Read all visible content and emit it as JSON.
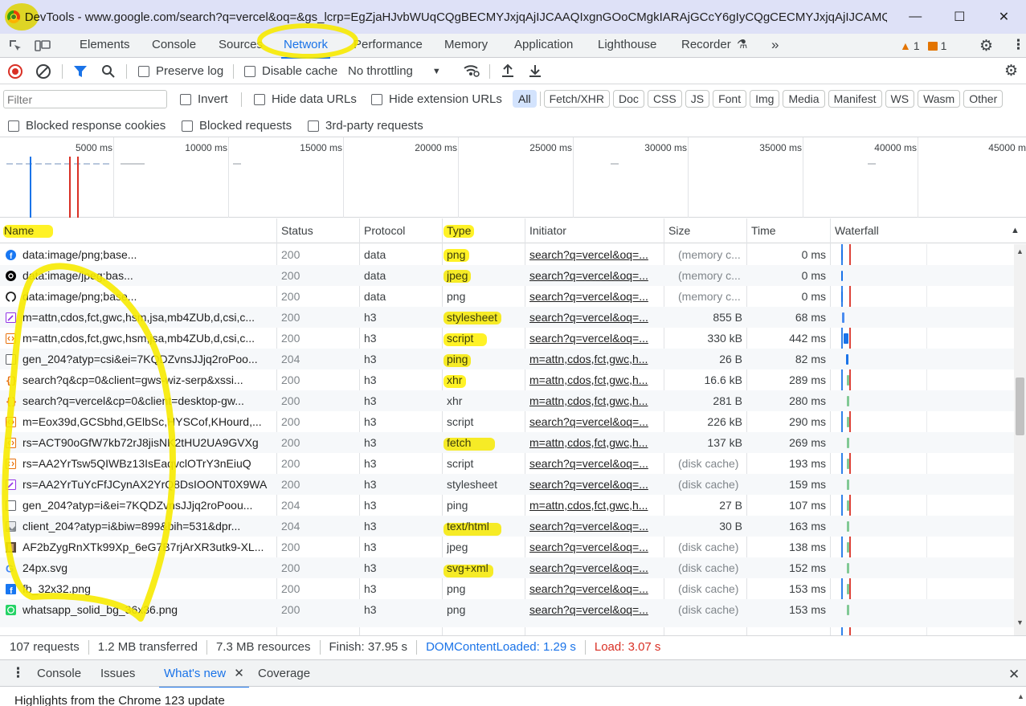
{
  "window": {
    "title": "DevTools - www.google.com/search?q=vercel&oq=&gs_lcrp=EgZjaHJvbWUqCQgBECMYJxjqAjIJCAAQIxgnGOoCMgkIARAjGCcY6gIyCQgCECMYJxjqAjIJCAMQI...",
    "minimize": "—",
    "maximize": "☐",
    "close": "✕"
  },
  "panel_tabs": [
    "Elements",
    "Console",
    "Sources",
    "Network",
    "Performance",
    "Memory",
    "Application",
    "Lighthouse",
    "Recorder"
  ],
  "active_panel": "Network",
  "more_tabs": "»",
  "warnings": {
    "warn_count": "1",
    "issue_count": "1"
  },
  "toolbar": {
    "preserve_log": "Preserve log",
    "disable_cache": "Disable cache",
    "throttling": "No throttling"
  },
  "filter_bar": {
    "placeholder": "Filter",
    "invert": "Invert",
    "hide_data_urls": "Hide data URLs",
    "hide_extension_urls": "Hide extension URLs",
    "types": [
      "All",
      "Fetch/XHR",
      "Doc",
      "CSS",
      "JS",
      "Font",
      "Img",
      "Media",
      "Manifest",
      "WS",
      "Wasm",
      "Other"
    ],
    "active_type": "All"
  },
  "blocked_bar": {
    "blocked_cookies": "Blocked response cookies",
    "blocked_requests": "Blocked requests",
    "third_party": "3rd-party requests"
  },
  "overview": {
    "ticks": [
      "5000 ms",
      "10000 ms",
      "15000 ms",
      "20000 ms",
      "25000 ms",
      "30000 ms",
      "35000 ms",
      "40000 ms",
      "45000 m"
    ]
  },
  "columns": [
    "Name",
    "Status",
    "Protocol",
    "Type",
    "Initiator",
    "Size",
    "Time",
    "Waterfall"
  ],
  "requests": [
    {
      "name": "data:image/png;base...",
      "status": "200",
      "protocol": "data",
      "type": "png",
      "initiator": "search?q=vercel&oq=...",
      "size": "(memory c...",
      "time": "0 ms",
      "icon": "facebook-icon"
    },
    {
      "name": "data:image/jpeg;bas...",
      "status": "200",
      "protocol": "data",
      "type": "jpeg",
      "initiator": "search?q=vercel&oq=...",
      "size": "(memory c...",
      "time": "0 ms",
      "icon": "threads-icon"
    },
    {
      "name": "data:image/png;base...",
      "status": "200",
      "protocol": "data",
      "type": "png",
      "initiator": "search?q=vercel&oq=...",
      "size": "(memory c...",
      "time": "0 ms",
      "icon": "github-icon"
    },
    {
      "name": "m=attn,cdos,fct,gwc,hsm,jsa,mb4ZUb,d,csi,c...",
      "status": "200",
      "protocol": "h3",
      "type": "stylesheet",
      "initiator": "search?q=vercel&oq=...",
      "size": "855 B",
      "time": "68 ms",
      "icon": "stylesheet-icon"
    },
    {
      "name": "m=attn,cdos,fct,gwc,hsm,jsa,mb4ZUb,d,csi,c...",
      "status": "200",
      "protocol": "h3",
      "type": "script",
      "initiator": "search?q=vercel&oq=...",
      "size": "330 kB",
      "time": "442 ms",
      "icon": "script-icon"
    },
    {
      "name": "gen_204?atyp=csi&ei=7KQDZvnsJJjq2roPoo...",
      "status": "204",
      "protocol": "h3",
      "type": "ping",
      "initiator": "m=attn,cdos,fct,gwc,h...",
      "size": "26 B",
      "time": "82 ms",
      "icon": "document-icon"
    },
    {
      "name": "search?q&cp=0&client=gws-wiz-serp&xssi...",
      "status": "200",
      "protocol": "h3",
      "type": "xhr",
      "initiator": "m=attn,cdos,fct,gwc,h...",
      "size": "16.6 kB",
      "time": "289 ms",
      "icon": "xhr-icon"
    },
    {
      "name": "search?q=vercel&cp=0&client=desktop-gw...",
      "status": "200",
      "protocol": "h3",
      "type": "xhr",
      "initiator": "m=attn,cdos,fct,gwc,h...",
      "size": "281 B",
      "time": "280 ms",
      "icon": "xhr-icon"
    },
    {
      "name": "m=Eox39d,GCSbhd,GElbSc,HYSCof,KHourd,...",
      "status": "200",
      "protocol": "h3",
      "type": "script",
      "initiator": "search?q=vercel&oq=...",
      "size": "226 kB",
      "time": "290 ms",
      "icon": "script-icon"
    },
    {
      "name": "rs=ACT90oGfW7kb72rJ8jisNK2tHU2UA9GVXg",
      "status": "200",
      "protocol": "h3",
      "type": "fetch",
      "initiator": "m=attn,cdos,fct,gwc,h...",
      "size": "137 kB",
      "time": "269 ms",
      "icon": "script-icon"
    },
    {
      "name": "rs=AA2YrTsw5QIWBz13IsEaqvclOTrY3nEiuQ",
      "status": "200",
      "protocol": "h3",
      "type": "script",
      "initiator": "search?q=vercel&oq=...",
      "size": "(disk cache)",
      "time": "193 ms",
      "icon": "script-icon"
    },
    {
      "name": "rs=AA2YrTuYcFfJCynAX2YrQ8DsIOONT0X9WA",
      "status": "200",
      "protocol": "h3",
      "type": "stylesheet",
      "initiator": "search?q=vercel&oq=...",
      "size": "(disk cache)",
      "time": "159 ms",
      "icon": "stylesheet-icon"
    },
    {
      "name": "gen_204?atyp=i&ei=7KQDZvnsJJjq2roPoou...",
      "status": "204",
      "protocol": "h3",
      "type": "ping",
      "initiator": "m=attn,cdos,fct,gwc,h...",
      "size": "27 B",
      "time": "107 ms",
      "icon": "document-icon"
    },
    {
      "name": "client_204?atyp=i&biw=899&bih=531&dpr...",
      "status": "204",
      "protocol": "h3",
      "type": "text/html",
      "initiator": "search?q=vercel&oq=...",
      "size": "30 B",
      "time": "163 ms",
      "icon": "image-icon"
    },
    {
      "name": "AF2bZygRnXTk99Xp_6eG7B7rjArXR3utk9-XL...",
      "status": "200",
      "protocol": "h3",
      "type": "jpeg",
      "initiator": "search?q=vercel&oq=...",
      "size": "(disk cache)",
      "time": "138 ms",
      "icon": "photo-icon"
    },
    {
      "name": "24px.svg",
      "status": "200",
      "protocol": "h3",
      "type": "svg+xml",
      "initiator": "search?q=vercel&oq=...",
      "size": "(disk cache)",
      "time": "152 ms",
      "icon": "google-icon"
    },
    {
      "name": "fb_32x32.png",
      "status": "200",
      "protocol": "h3",
      "type": "png",
      "initiator": "search?q=vercel&oq=...",
      "size": "(disk cache)",
      "time": "153 ms",
      "icon": "facebook-square-icon"
    },
    {
      "name": "whatsapp_solid_bg_36x36.png",
      "status": "200",
      "protocol": "h3",
      "type": "png",
      "initiator": "search?q=vercel&oq=...",
      "size": "(disk cache)",
      "time": "153 ms",
      "icon": "whatsapp-icon"
    }
  ],
  "summary": {
    "requests": "107 requests",
    "transferred": "1.2 MB transferred",
    "resources": "7.3 MB resources",
    "finish": "Finish: 37.95 s",
    "dcl": "DOMContentLoaded: 1.29 s",
    "load": "Load: 3.07 s"
  },
  "drawer": {
    "tabs": [
      "Console",
      "Issues",
      "What's new",
      "Coverage"
    ],
    "active": "What's new",
    "content": "Highlights from the Chrome 123 update"
  },
  "colors": {
    "accent": "#1a73e8",
    "highlight": "#fff000",
    "load_line": "#d93025",
    "dcl_line": "#1a73e8"
  }
}
